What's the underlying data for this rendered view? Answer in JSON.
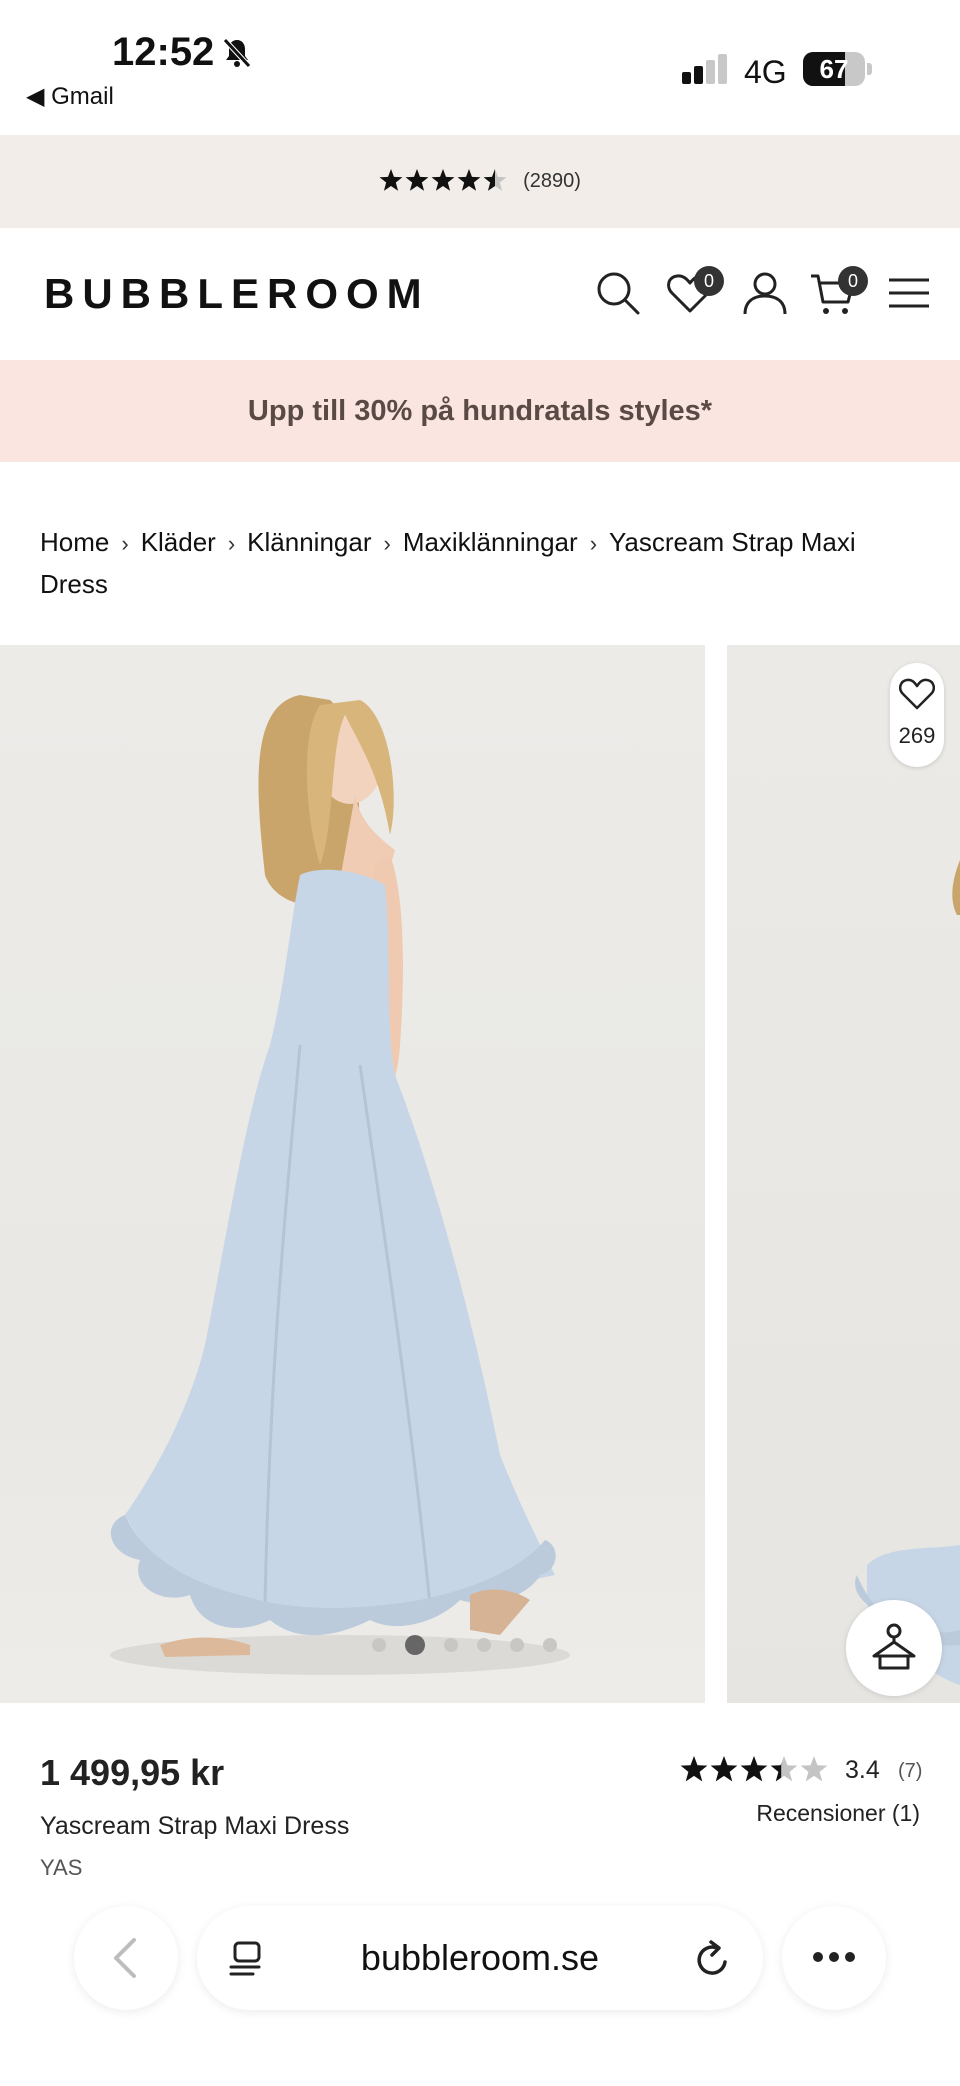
{
  "status_bar": {
    "time": "12:52",
    "back_app": "◀ Gmail",
    "network": "4G",
    "battery": "67",
    "battery_level": 0.67
  },
  "rating_banner": {
    "stars": 4.5,
    "count": "(2890)"
  },
  "header": {
    "logo": "BUBBLEROOM",
    "wishlist_count": "0",
    "cart_count": "0"
  },
  "promo": {
    "text": "Upp till 30% på hundratals styles*"
  },
  "breadcrumb": {
    "items": [
      "Home",
      "Kläder",
      "Klänningar",
      "Maxiklänningar",
      "Yascream Strap Maxi Dress"
    ],
    "separator": "›"
  },
  "gallery": {
    "favorites_count": "269",
    "dot_count": 6,
    "active_dot": 1,
    "dress_color": "#c7d6e6"
  },
  "product": {
    "price": "1 499,95 kr",
    "name": "Yascream Strap Maxi Dress",
    "brand": "YAS",
    "rating_value": "3.4",
    "rating_count": "(7)",
    "reviews_link": "Recensioner (1)",
    "rating_stars": 3.4
  },
  "browser": {
    "url": "bubbleroom.se"
  },
  "colors": {
    "rating_banner_bg": "#f2ede8",
    "promo_bg": "#fae5e1",
    "promo_text": "#5a4a46"
  }
}
